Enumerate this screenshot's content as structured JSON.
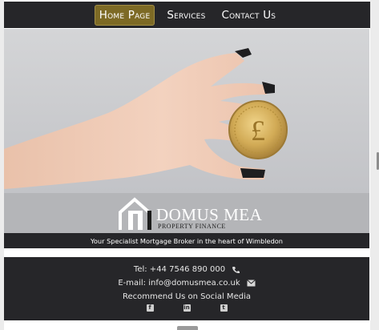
{
  "nav": {
    "items": [
      {
        "label": "Home Page",
        "active": true
      },
      {
        "label": "Services",
        "active": false
      },
      {
        "label": "Contact Us",
        "active": false
      }
    ]
  },
  "hero": {
    "coin_symbol": "£"
  },
  "logo": {
    "name": "DOMUS MEA",
    "subtitle": "PROPERTY FINANCE"
  },
  "tagline": "Your Specialist Mortgage Broker in the heart of Wimbledon",
  "footer": {
    "phone": "Tel: +44 7546 890 000",
    "email": "E-mail: info@domusmea.co.uk",
    "social_heading": "Recommend Us on Social Media",
    "social": [
      {
        "icon": "facebook-icon",
        "glyph": "f"
      },
      {
        "icon": "linkedin-icon",
        "glyph": "in"
      },
      {
        "icon": "twitter-icon",
        "glyph": "t"
      }
    ]
  },
  "colors": {
    "bar": "#262629",
    "active_nav": "#7d6a25",
    "coin": "#c9a24b"
  }
}
